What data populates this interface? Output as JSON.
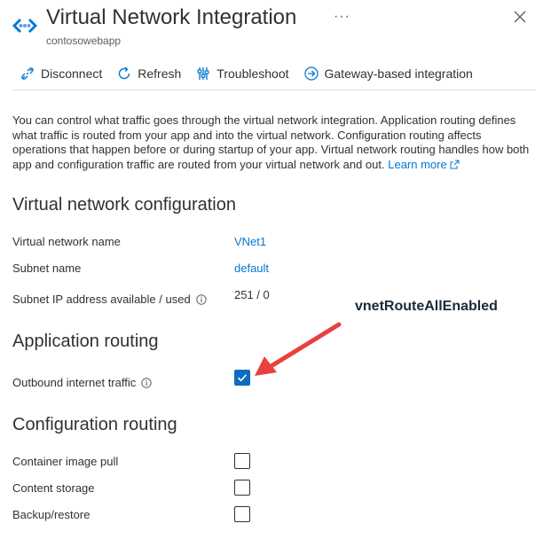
{
  "header": {
    "title": "Virtual Network Integration",
    "subtitle": "contosowebapp",
    "more_label": "···"
  },
  "toolbar": {
    "items": [
      {
        "label": "Disconnect",
        "icon": "disconnect-icon"
      },
      {
        "label": "Refresh",
        "icon": "refresh-icon"
      },
      {
        "label": "Troubleshoot",
        "icon": "troubleshoot-icon"
      },
      {
        "label": "Gateway-based integration",
        "icon": "arrow-circle-icon"
      }
    ]
  },
  "description": {
    "text": "You can control what traffic goes through the virtual network integration. Application routing defines what traffic is routed from your app and into the virtual network. Configuration routing affects operations that happen before or during startup of your app. Virtual network routing handles how both app and configuration traffic are routed from your virtual network and out.",
    "link": "Learn more"
  },
  "vnet_config": {
    "heading": "Virtual network configuration",
    "rows": [
      {
        "label": "Virtual network name",
        "value": "VNet1"
      },
      {
        "label": "Subnet name",
        "value": "default"
      },
      {
        "label": "Subnet IP address available / used",
        "value": "251 / 0"
      }
    ]
  },
  "app_routing": {
    "heading": "Application routing",
    "outbound_label": "Outbound internet traffic",
    "outbound_checked": true
  },
  "annotation": {
    "text": "vnetRouteAllEnabled",
    "color": "#e8413e"
  },
  "config_routing": {
    "heading": "Configuration routing",
    "items": [
      {
        "label": "Container image pull",
        "checked": false
      },
      {
        "label": "Content storage",
        "checked": false
      },
      {
        "label": "Backup/restore",
        "checked": false
      }
    ]
  },
  "colors": {
    "accent": "#0078d4",
    "checkbox_checked": "#0f6cbd"
  }
}
